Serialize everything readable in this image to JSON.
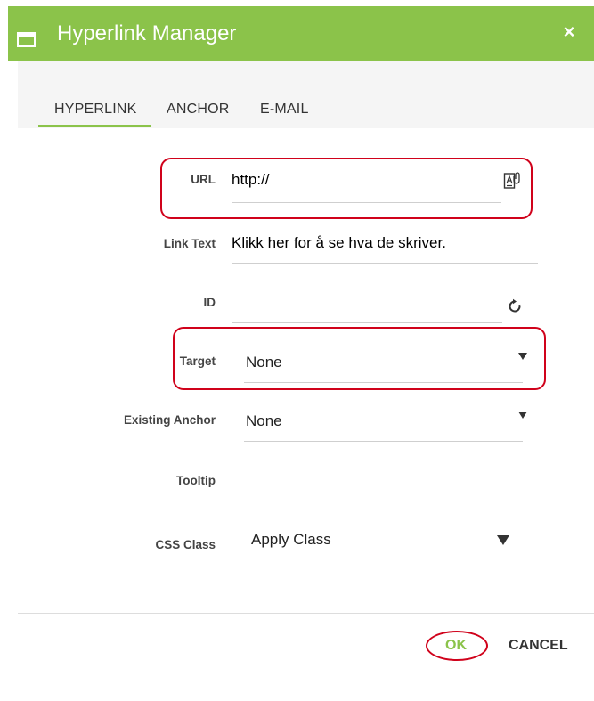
{
  "dialog": {
    "title": "Hyperlink Manager",
    "close_glyph": "×",
    "title_icon": "window-icon"
  },
  "tabs": [
    {
      "label": "HYPERLINK",
      "active": true
    },
    {
      "label": "ANCHOR",
      "active": false
    },
    {
      "label": "E-MAIL",
      "active": false
    }
  ],
  "form": {
    "url": {
      "label": "URL",
      "value": "http://",
      "icon": "document-browse-icon"
    },
    "link_text": {
      "label": "Link Text",
      "value": "Klikk her for å se hva de skriver."
    },
    "id": {
      "label": "ID",
      "value": "",
      "icon": "refresh-icon"
    },
    "target": {
      "label": "Target",
      "selected": "None"
    },
    "existing_anchor": {
      "label": "Existing Anchor",
      "selected": "None"
    },
    "tooltip": {
      "label": "Tooltip",
      "value": ""
    },
    "css_class": {
      "label": "CSS Class",
      "selected": "Apply Class"
    }
  },
  "footer": {
    "ok_label": "OK",
    "cancel_label": "CANCEL"
  },
  "colors": {
    "accent": "#8bc34a",
    "annotation": "#d0021b"
  }
}
